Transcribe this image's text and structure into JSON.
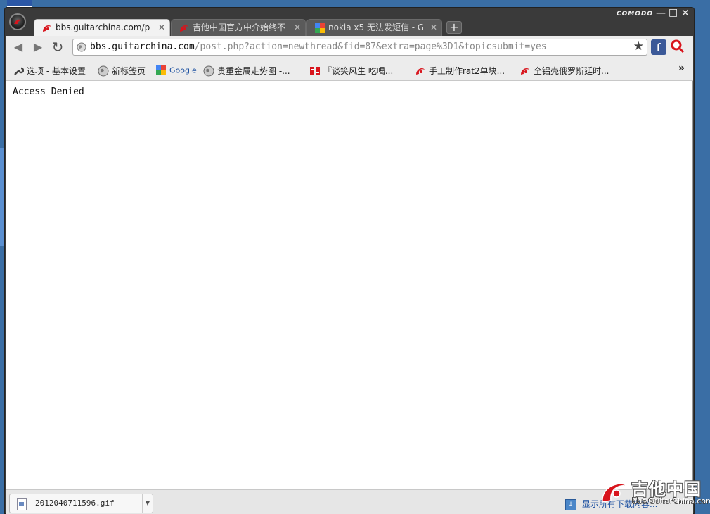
{
  "browser": {
    "brand": "COMODO",
    "tabs": [
      {
        "label": "bbs.guitarchina.com/pos",
        "favicon": "guitarchina-icon",
        "active": true
      },
      {
        "label": "吉他中国官方中介始终不",
        "favicon": "guitarchina-icon",
        "active": false
      },
      {
        "label": "nokia x5 无法发短信 - G",
        "favicon": "google-icon",
        "active": false
      }
    ],
    "new_tab": "+",
    "window_controls": {
      "minimize": "—",
      "maximize": "□",
      "close": "✕"
    }
  },
  "toolbar": {
    "back": "◀",
    "forward": "▶",
    "reload": "↻",
    "url_host": "bbs.guitarchina.com",
    "url_path": "/post.php?action=newthread&fid=87&extra=page%3D1&topicsubmit=yes",
    "star": "★",
    "facebook": "f"
  },
  "bookmarks": {
    "items": [
      {
        "label": "选项 - 基本设置",
        "icon": "wrench-icon"
      },
      {
        "label": "新标签页",
        "icon": "globe-icon"
      },
      {
        "label": "Google",
        "icon": "google-icon"
      },
      {
        "label": "贵重金属走势图 -...",
        "icon": "globe-icon"
      },
      {
        "label": "『谈笑风生 吃喝...",
        "icon": "forum-icon"
      },
      {
        "label": "手工制作rat2单块...",
        "icon": "guitarchina-icon"
      },
      {
        "label": "全铝壳俄罗斯延时...",
        "icon": "guitarchina-icon"
      }
    ],
    "more": "»"
  },
  "content": {
    "message": "Access Denied"
  },
  "downloads": {
    "file_name": "2012040711596.gif",
    "show_all": "显示所有下载内容..."
  },
  "watermark": {
    "title": "吉他中国",
    "url": "bbs.GuitarChina.com"
  },
  "colors": {
    "desktop": "#3a6ea5",
    "frame": "#3a3a3a",
    "brand_red": "#d8141c"
  }
}
